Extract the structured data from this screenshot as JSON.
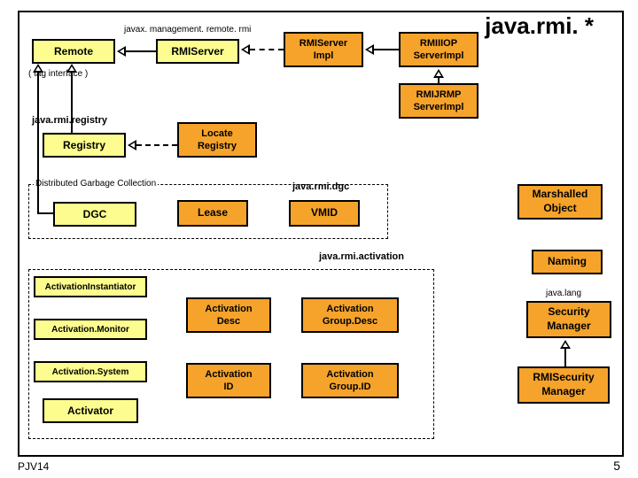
{
  "title": "java.rmi. *",
  "labels": {
    "javax_mgmt": "javax. management. remote. rmi",
    "tag_interface": "( tag interface )",
    "pkg_registry": "java.rmi.registry",
    "dgc_title": "Distributed Garbage Collection",
    "pkg_dgc": "java.rmi.dgc",
    "pkg_activation": "java.rmi.activation",
    "pkg_lang": "java.lang"
  },
  "boxes": {
    "remote": "Remote",
    "rmiserver": "RMIServer",
    "rmiserverimpl": {
      "l1": "RMIServer",
      "l2": "Impl"
    },
    "rmiiiop": {
      "l1": "RMIIIOP",
      "l2": "ServerImpl"
    },
    "rmijrmp": {
      "l1": "RMIJRMP",
      "l2": "ServerImpl"
    },
    "registry": "Registry",
    "locateregistry": {
      "l1": "Locate",
      "l2": "Registry"
    },
    "dgc": "DGC",
    "lease": "Lease",
    "vmid": "VMID",
    "marshalled": {
      "l1": "Marshalled",
      "l2": "Object"
    },
    "naming": "Naming",
    "securitymgr": {
      "l1": "Security",
      "l2": "Manager"
    },
    "rmisecuritymgr": {
      "l1": "RMISecurity",
      "l2": "Manager"
    },
    "act_instantiator": "ActivationInstantiator",
    "act_monitor": "Activation.Monitor",
    "act_system": "Activation.System",
    "activator": "Activator",
    "act_desc": {
      "l1": "Activation",
      "l2": "Desc"
    },
    "act_groupdesc": {
      "l1": "Activation",
      "l2": "Group.Desc"
    },
    "act_id": {
      "l1": "Activation",
      "l2": "ID"
    },
    "act_groupid": {
      "l1": "Activation",
      "l2": "Group.ID"
    }
  },
  "footer": {
    "left": "PJV14",
    "right": "5"
  }
}
